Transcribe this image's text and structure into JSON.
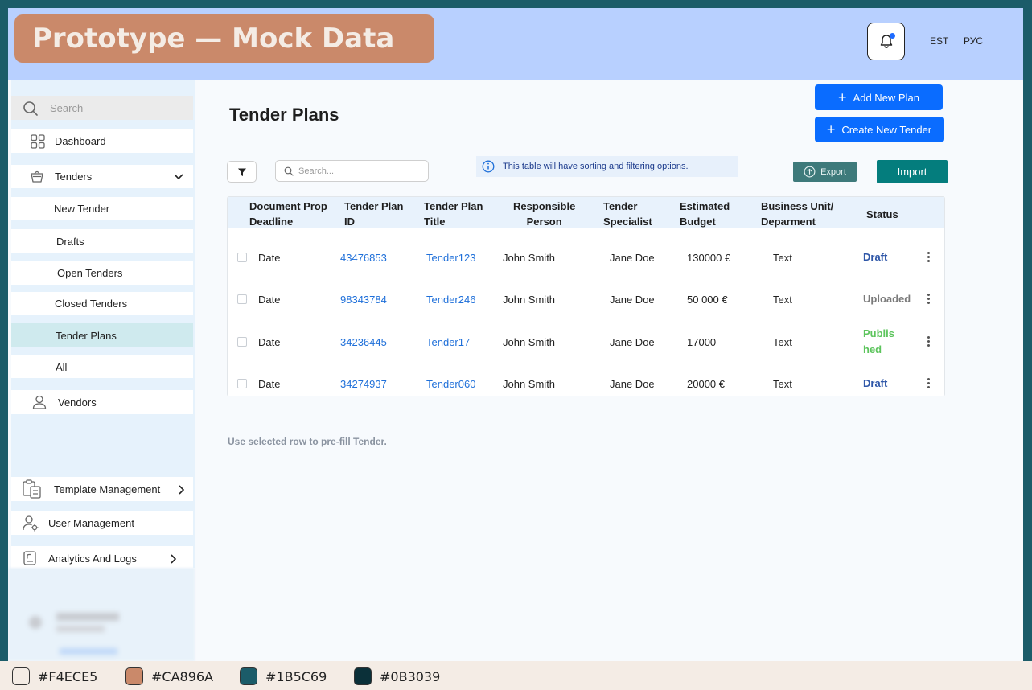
{
  "banner": {
    "label": "Prototype — Mock Data"
  },
  "header": {
    "lang_et": "EST",
    "lang_ru": "РУС"
  },
  "sidebar": {
    "search_placeholder": "Search",
    "items": [
      {
        "label": "Dashboard",
        "icon": "grid-icon"
      },
      {
        "label": "Tenders",
        "icon": "basket-icon"
      },
      {
        "label": "New Tender"
      },
      {
        "label": "Drafts"
      },
      {
        "label": "Open Tenders"
      },
      {
        "label": "Closed Tenders"
      },
      {
        "label": "Tender Plans",
        "active": true
      },
      {
        "label": "All"
      },
      {
        "label": "Vendors",
        "icon": "user-icon"
      },
      {
        "label": "Template Management",
        "icon": "clipboard-icon"
      },
      {
        "label": "User Management",
        "icon": "user-gear-icon"
      },
      {
        "label": "Analytics And Logs",
        "icon": "report-icon"
      }
    ]
  },
  "main": {
    "title": "Tender Plans",
    "add_plan_label": "Add New Plan",
    "create_tender_label": "Create New Tender",
    "search_placeholder": "Search...",
    "info_text": "This table will have sorting and filtering options.",
    "export_label": "Export",
    "import_label": "Import",
    "footnote": "Use selected row to pre-fill Tender."
  },
  "table": {
    "headers": [
      [
        "Document Prop",
        "Deadline"
      ],
      [
        "Tender Plan",
        "ID"
      ],
      [
        "Tender Plan",
        "Title"
      ],
      [
        "Responsible",
        "Person"
      ],
      [
        "Tender",
        "Specialist"
      ],
      [
        "Estimated",
        "Budget"
      ],
      [
        "Business Unit/",
        "Deparment"
      ],
      [
        "Status",
        ""
      ]
    ],
    "rows": [
      {
        "deadline": "Date",
        "id": "43476853",
        "title": "Tender123",
        "responsible": "John Smith",
        "specialist": "Jane Doe",
        "budget": "130000 €",
        "unit": "Text",
        "status_l1": "Draft",
        "status_l2": "",
        "status_color": "#2F57A8"
      },
      {
        "deadline": "Date",
        "id": "98343784",
        "title": "Tender246",
        "responsible": "John Smith",
        "specialist": "Jane Doe",
        "budget": "50 000 €",
        "unit": "Text",
        "status_l1": "Uploaded",
        "status_l2": "",
        "status_color": "#7A7A7A"
      },
      {
        "deadline": "Date",
        "id": "34236445",
        "title": "Tender17",
        "responsible": "John Smith",
        "specialist": "Jane Doe",
        "budget": "17000",
        "unit": "Text",
        "status_l1": "Publis",
        "status_l2": "hed",
        "status_color": "#5CC45C"
      },
      {
        "deadline": "Date",
        "id": "34274937",
        "title": "Tender060",
        "responsible": "John Smith",
        "specialist": "Jane Doe",
        "budget": "20000 €",
        "unit": "Text",
        "status_l1": "Draft",
        "status_l2": "",
        "status_color": "#2F57A8"
      }
    ]
  },
  "palette": [
    {
      "hex": "#F4ECE5",
      "label": "#F4ECE5"
    },
    {
      "hex": "#CA896A",
      "label": "#CA896A"
    },
    {
      "hex": "#1B5C69",
      "label": "#1B5C69"
    },
    {
      "hex": "#0B3039",
      "label": "#0B3039"
    }
  ]
}
